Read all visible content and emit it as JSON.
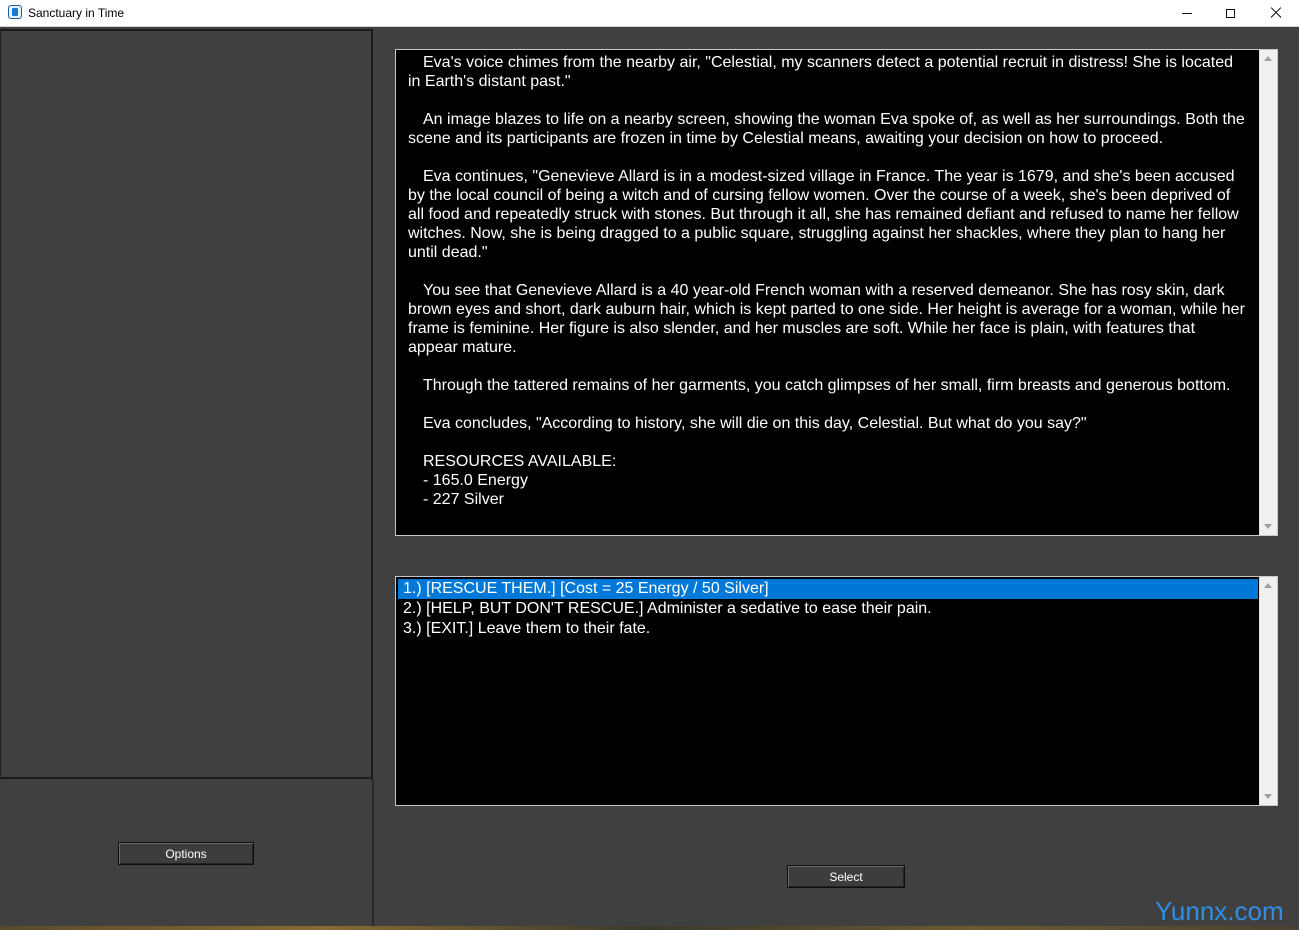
{
  "window": {
    "title": "Sanctuary in Time"
  },
  "story": {
    "paragraphs": [
      "Eva's voice chimes from the nearby air, \"Celestial, my scanners detect a potential recruit in distress! She is located in Earth's distant past.\"",
      "An image blazes to life on a nearby screen, showing the woman Eva spoke of, as well as her surroundings. Both the scene and its participants are frozen in time by Celestial means, awaiting your decision on how to proceed.",
      "Eva continues, \"Genevieve Allard is in a modest-sized village in France. The year is 1679, and she's been accused by the local council of being a witch and of cursing fellow women. Over the course of a week, she's been deprived of all food and repeatedly struck with stones. But through it all, she has remained defiant and refused to name her fellow witches. Now, she is being dragged to a public square, struggling against her shackles, where they plan to hang her until dead.\"",
      "You see that Genevieve Allard is a 40 year-old French woman with a reserved demeanor. She has rosy skin, dark brown eyes and short, dark auburn hair, which is kept parted to one side. Her height is average for a woman, while her frame is feminine. Her figure is also slender, and her muscles are soft. While her face is plain, with features that appear mature.",
      "Through the tattered remains of her garments, you catch glimpses of her small, firm breasts and generous bottom.",
      "Eva concludes, \"According to history, she will die on this day, Celestial. But what do you say?\""
    ],
    "resources_header": "RESOURCES AVAILABLE:",
    "resources": [
      "- 165.0 Energy",
      "- 227 Silver"
    ]
  },
  "choices": [
    "1.) [RESCUE THEM.] [Cost = 25 Energy / 50 Silver]",
    "2.) [HELP, BUT DON'T RESCUE.] Administer a sedative to ease their pain.",
    "3.) [EXIT.] Leave them to their fate."
  ],
  "selected_choice": 0,
  "buttons": {
    "options": "Options",
    "select": "Select"
  },
  "watermark": "Yunnx.com",
  "icons": {
    "app": "app-icon",
    "minimize": "minimize-icon",
    "maximize": "maximize-icon",
    "close": "close-icon"
  },
  "colors": {
    "background": "#404040",
    "text_panel": "#000000",
    "selection": "#0078d7",
    "watermark": "#2f8fe6"
  }
}
